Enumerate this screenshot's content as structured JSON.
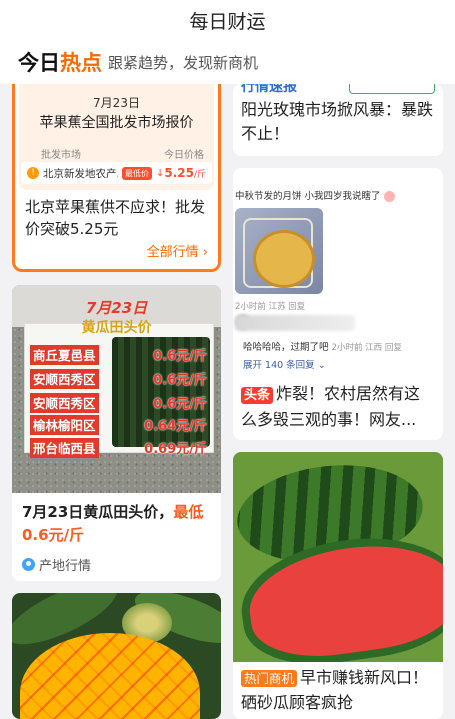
{
  "top_bar": {
    "title": "每日财运"
  },
  "hot_bar": {
    "title_a": "今日",
    "title_b": "热点",
    "subtitle": "跟紧趋势，发现新商机"
  },
  "price_card": {
    "date": "7月23日",
    "title": "苹果蕉全国批发市场报价",
    "col_market": "批发市场",
    "col_price": "今日价格",
    "market": "北京新发地农产...",
    "badge": "最低价",
    "price": "5.25",
    "unit": "/斤",
    "headline": "北京苹果蕉供不应求！批发价突破5.25元",
    "more": "全部行情"
  },
  "rose_card": {
    "tag": "行情速报",
    "title": "阳光玫瑰市场掀风暴：暴跌不止！"
  },
  "cucumber_card": {
    "heading": "7月23日",
    "subheading": "黄瓜田头价",
    "rows": [
      {
        "place": "商丘夏邑县",
        "price": "0.6元/斤"
      },
      {
        "place": "安顺西秀区",
        "price": "0.6元/斤"
      },
      {
        "place": "安顺西秀区",
        "price": "0.6元/斤"
      },
      {
        "place": "榆林榆阳区",
        "price": "0.64元/斤"
      },
      {
        "place": "邢台临西县",
        "price": "0.69元/斤"
      }
    ],
    "title_a": "7月23日黄瓜田头价，",
    "title_b": "最低0.6元/斤",
    "source": "产地行情"
  },
  "mooncake_card": {
    "post_head": "中秋节发的月饼 小我四岁我说瞎了",
    "meta": "2小时前 江苏 回复",
    "reply": "哈哈哈哈，过期了吧",
    "reply_meta": "2小时前 江西 回复",
    "expand": "展开 140 条回复",
    "tag": "头条",
    "title": "炸裂！农村居然有这么多毁三观的事！网友..."
  },
  "watermelon_card": {
    "tag": "热门商机",
    "title": "早市赚钱新风口！硒砂瓜顾客疯抢"
  },
  "colors": {
    "accent_orange": "#ff6a00",
    "red": "#ff3b2f",
    "blue_link": "#3a5ea8"
  }
}
